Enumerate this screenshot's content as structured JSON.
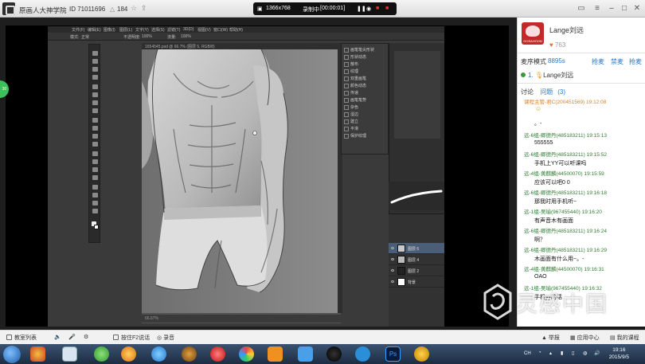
{
  "topbar": {
    "title": "原画人大神学院",
    "room_id": "ID 71011696",
    "viewers": "184",
    "resolution": "1366x768",
    "recording_label": "录制中",
    "recording_time": "[00:00:01]"
  },
  "photoshop": {
    "menu": [
      "文件(F)",
      "编辑(E)",
      "图像(I)",
      "图层(L)",
      "文字(Y)",
      "选择(S)",
      "滤镜(T)",
      "3D(D)",
      "视图(V)",
      "窗口(W)",
      "帮助(H)"
    ],
    "options": [
      "模式:",
      "正常",
      "不透明度:",
      "100%",
      "流量:",
      "100%"
    ],
    "doc_tab": "1654545.psd @ 66.7% (图层 5, RGB/8)",
    "status": "66.67%",
    "brush_panel_rows": [
      "画笔笔尖形状",
      "形状动态",
      "散布",
      "纹理",
      "双重画笔",
      "颜色动态",
      "传递",
      "画笔笔势",
      "杂色",
      "湿边",
      "建立",
      "平滑",
      "保护纹理"
    ],
    "layers": [
      "图层 6",
      "图层 4",
      "图层 2",
      "背景"
    ]
  },
  "sidepanel": {
    "host_name": "Lange刘远",
    "logo_text": "GOSAHOON",
    "likes": "763",
    "mode_label": "麦序模式",
    "mode_value": "8895s",
    "links": [
      "抢麦",
      "禁麦",
      "抢麦"
    ],
    "queue_label": "1.",
    "queue_name": "Lange刘远",
    "tab_discuss": "讨论",
    "tab_question": "问题",
    "tab_question_count": "(3)",
    "messages": [
      {
        "head": "课程主管-君C(200451569) 19:12:08",
        "body": "",
        "sys": true
      },
      {
        "head": "",
        "body": "。-"
      },
      {
        "head": "远-6组-卿德丹(485183211) 19:15:13",
        "body": "555555"
      },
      {
        "head": "远-6组-卿德丹(485183211) 19:15:52",
        "body": "手机上YY可以听课吗"
      },
      {
        "head": "远-4组-黄麒麟(44500070) 19:15:59",
        "body": "应该可以吧0 0"
      },
      {
        "head": "远-6组-卿德丹(485183211) 19:16:18",
        "body": "那我时用手机听~"
      },
      {
        "head": "远-1组-吴瑜(967455440) 19:16:20",
        "body": "有声音木有画面"
      },
      {
        "head": "远-6组-卿德丹(485183211) 19:16:24",
        "body": "啊？"
      },
      {
        "head": "远-6组-卿德丹(485183211) 19:16:29",
        "body": "木画面有什么用~。-"
      },
      {
        "head": "远-4组-黄麒麟(44500070) 19:16:31",
        "body": "OAO"
      },
      {
        "head": "远-1组-吴瑜(967455440) 19:16:32",
        "body": "手机yy的话"
      }
    ]
  },
  "bottombar": {
    "items": [
      "教室列表",
      "",
      "按住F2说话",
      "录音"
    ],
    "right_items": [
      "举报",
      "应用中心",
      "我的课程"
    ]
  },
  "taskbar": {
    "time": "19:16",
    "date": "2015/9/5",
    "lang": "CH"
  },
  "watermark": {
    "text": "灵感中国",
    "url": "lingganchina.com"
  },
  "side_badge": "30"
}
